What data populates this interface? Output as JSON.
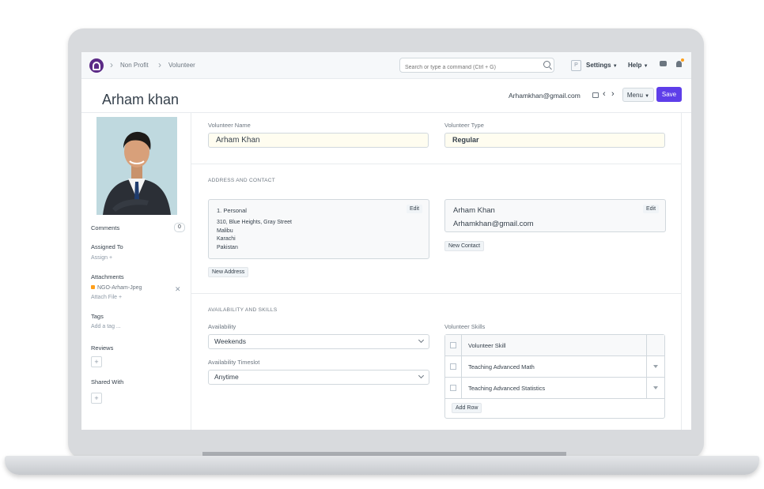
{
  "navbar": {
    "breadcrumbs": [
      "Non Profit",
      "Volunteer"
    ],
    "search_placeholder": "Search or type a command (Ctrl + G)",
    "avatar_letter": "P",
    "settings_label": "Settings",
    "help_label": "Help"
  },
  "header": {
    "title": "Arham khan",
    "email": "Arhamkhan@gmail.com",
    "menu_label": "Menu",
    "save_label": "Save"
  },
  "sidebar": {
    "comments_label": "Comments",
    "comments_count": "0",
    "assigned_to_label": "Assigned To",
    "assign_label": "Assign +",
    "attachments_label": "Attachments",
    "attachment_name": "NGO-Arham-Jpeg",
    "attach_file_label": "Attach File +",
    "tags_label": "Tags",
    "add_tag_label": "Add a tag ...",
    "reviews_label": "Reviews",
    "shared_with_label": "Shared With"
  },
  "form": {
    "volunteer_name_label": "Volunteer Name",
    "volunteer_name": "Arham Khan",
    "volunteer_type_label": "Volunteer Type",
    "volunteer_type": "Regular",
    "address_section_title": "ADDRESS AND CONTACT",
    "address": {
      "title": "1. Personal",
      "lines": [
        "310, Blue Heights, Gray Street",
        "Malibu",
        "Karachi",
        "Pakistan"
      ],
      "edit_label": "Edit"
    },
    "new_address_label": "New Address",
    "contact": {
      "name": "Arham Khan",
      "email": "Arhamkhan@gmail.com",
      "edit_label": "Edit"
    },
    "new_contact_label": "New Contact",
    "skills_section_title": "AVAILABILITY AND SKILLS",
    "availability_label": "Availability",
    "availability": "Weekends",
    "timeslot_label": "Availability Timeslot",
    "timeslot": "Anytime",
    "skills_label": "Volunteer Skills",
    "skills_header": "Volunteer Skill",
    "skills": [
      "Teaching Advanced Math",
      "Teaching Advanced Statistics"
    ],
    "add_row_label": "Add Row"
  }
}
